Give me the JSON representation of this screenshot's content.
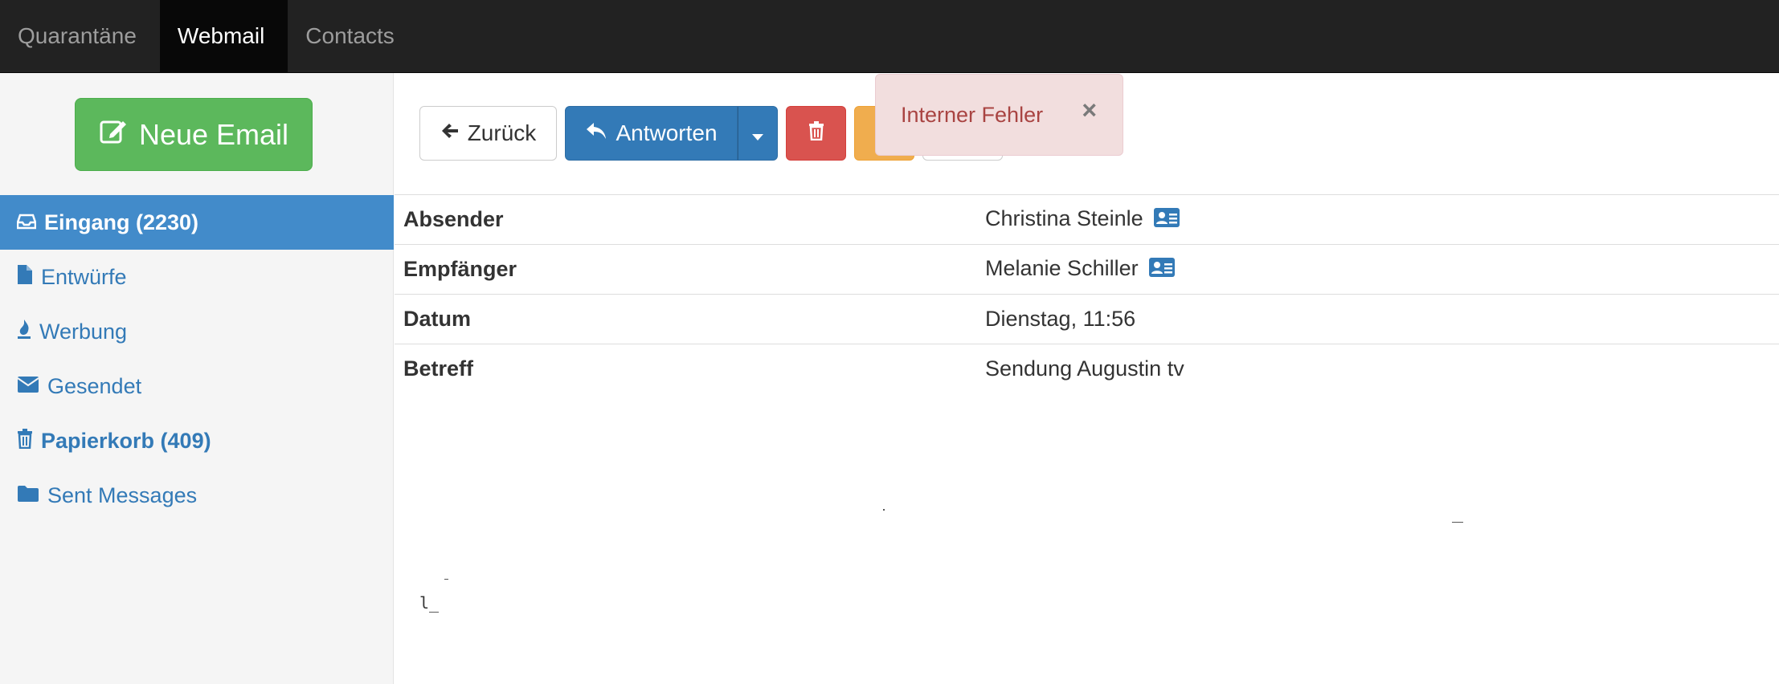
{
  "nav": {
    "items": [
      {
        "label": "Quarantäne",
        "active": false
      },
      {
        "label": "Webmail",
        "active": true
      },
      {
        "label": "Contacts",
        "active": false
      }
    ]
  },
  "sidebar": {
    "compose_label": "Neue Email",
    "folders": [
      {
        "label": "Eingang (2230)",
        "icon": "inbox-icon",
        "active": true
      },
      {
        "label": "Entwürfe",
        "icon": "file-icon",
        "active": false
      },
      {
        "label": "Werbung",
        "icon": "fire-icon",
        "active": false
      },
      {
        "label": "Gesendet",
        "icon": "envelope-icon",
        "active": false
      },
      {
        "label": "Papierkorb (409)",
        "icon": "trash-icon",
        "active": false
      },
      {
        "label": "Sent Messages",
        "icon": "folder-icon",
        "active": false
      }
    ]
  },
  "toolbar": {
    "back_label": "Zurück",
    "reply_label": "Antworten"
  },
  "alert": {
    "message": "Interner Fehler",
    "close_symbol": "×"
  },
  "message": {
    "headers": [
      {
        "label": "Absender",
        "value": "Christina Steinle",
        "has_contact_icon": true
      },
      {
        "label": "Empfänger",
        "value": "Melanie Schiller",
        "has_contact_icon": true
      },
      {
        "label": "Datum",
        "value": "Dienstag, 11:56",
        "has_contact_icon": false
      },
      {
        "label": "Betreff",
        "value": "Sendung Augustin tv",
        "has_contact_icon": false
      }
    ],
    "body_fragment": "l_"
  },
  "colors": {
    "navbar_bg": "#222222",
    "compose_green": "#5cb85c",
    "primary_blue": "#337ab7",
    "danger_red": "#d9534f",
    "warning_orange": "#f0ad4e",
    "alert_bg": "#f2dede",
    "alert_text": "#a94442"
  }
}
